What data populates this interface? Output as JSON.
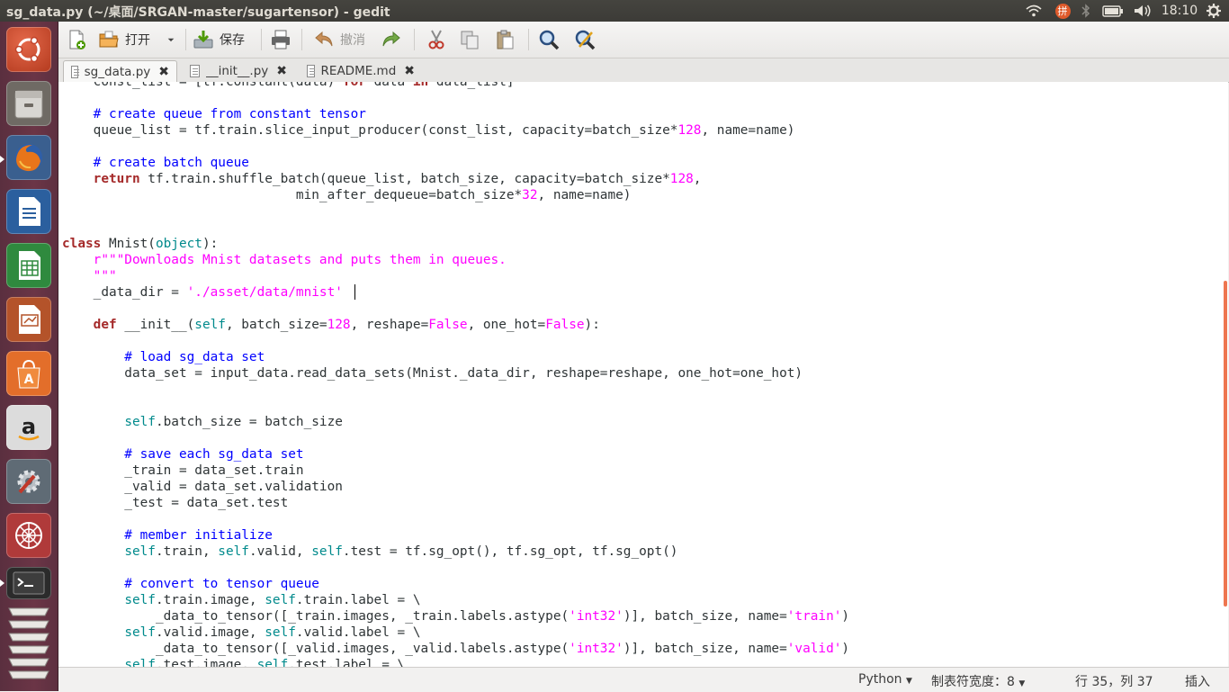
{
  "window": {
    "title": "sg_data.py (~/桌面/SRGAN-master/sugartensor) - gedit"
  },
  "panel": {
    "clock": "18:10",
    "input_method": "拼"
  },
  "toolbar": {
    "open_label": "打开",
    "save_label": "保存",
    "undo_label": "撤消"
  },
  "tabs": [
    {
      "label": "sg_data.py"
    },
    {
      "label": "__init__.py"
    },
    {
      "label": "README.md"
    }
  ],
  "code": {
    "l0": {
      "a": "    const_list = [tf.constant(data) ",
      "b": "for",
      "c": " data ",
      "d": "in",
      "e": " data_list]"
    },
    "l1": {
      "a": "    # create queue from constant tensor"
    },
    "l2": {
      "a": "    queue_list = tf.train.slice_input_producer(const_list, capacity=batch_size*",
      "b": "128",
      "c": ", name=name)"
    },
    "l3": {
      "a": "    # create batch queue"
    },
    "l4": {
      "a": "    ",
      "b": "return",
      "c": " tf.train.shuffle_batch(queue_list, batch_size, capacity=batch_size*",
      "d": "128",
      "e": ","
    },
    "l5": {
      "a": "                              min_after_dequeue=batch_size*",
      "b": "32",
      "c": ", name=name)"
    },
    "l6": {
      "a": "class",
      "b": " Mnist(",
      "c": "object",
      "d": "):"
    },
    "l7": {
      "a": "    r\"\"\"Downloads Mnist datasets and puts them in queues."
    },
    "l8": {
      "a": "    \"\"\""
    },
    "l9": {
      "a": "    _data_dir = ",
      "b": "'./asset/data/mnist'"
    },
    "l10": {
      "a": "    ",
      "b": "def",
      "c": " __init__(",
      "d": "self",
      "e": ", batch_size=",
      "f": "128",
      "g": ", reshape=",
      "h": "False",
      "i": ", one_hot=",
      "j": "False",
      "k": "):"
    },
    "l11": {
      "a": "        # load sg_data set"
    },
    "l12": {
      "a": "        data_set = input_data.read_data_sets(Mnist._data_dir, reshape=reshape, one_hot=one_hot)"
    },
    "l13": {
      "a": "        ",
      "b": "self",
      "c": ".batch_size = batch_size"
    },
    "l14": {
      "a": "        # save each sg_data set"
    },
    "l15": {
      "a": "        _train = data_set.train"
    },
    "l16": {
      "a": "        _valid = data_set.validation"
    },
    "l17": {
      "a": "        _test = data_set.test"
    },
    "l18": {
      "a": "        # member initialize"
    },
    "l19": {
      "a": "        ",
      "b": "self",
      "c": ".train, ",
      "d": "self",
      "e": ".valid, ",
      "f": "self",
      "g": ".test = tf.sg_opt(), tf.sg_opt, tf.sg_opt()"
    },
    "l20": {
      "a": "        # convert to tensor queue"
    },
    "l21": {
      "a": "        ",
      "b": "self",
      "c": ".train.image, ",
      "d": "self",
      "e": ".train.label = \\"
    },
    "l22": {
      "a": "            _data_to_tensor([_train.images, _train.labels.astype(",
      "b": "'int32'",
      "c": ")], batch_size, name=",
      "d": "'train'",
      "e": ")"
    },
    "l23": {
      "a": "        ",
      "b": "self",
      "c": ".valid.image, ",
      "d": "self",
      "e": ".valid.label = \\"
    },
    "l24": {
      "a": "            _data_to_tensor([_valid.images, _valid.labels.astype(",
      "b": "'int32'",
      "c": ")], batch_size, name=",
      "d": "'valid'",
      "e": ")"
    },
    "l25": {
      "a": "        ",
      "b": "self",
      "c": ".test.image, ",
      "d": "self",
      "e": ".test.label = \\"
    }
  },
  "status": {
    "language": "Python",
    "tab_width": "制表符宽度：8",
    "position": "行 35，列 37",
    "mode": "插入"
  }
}
